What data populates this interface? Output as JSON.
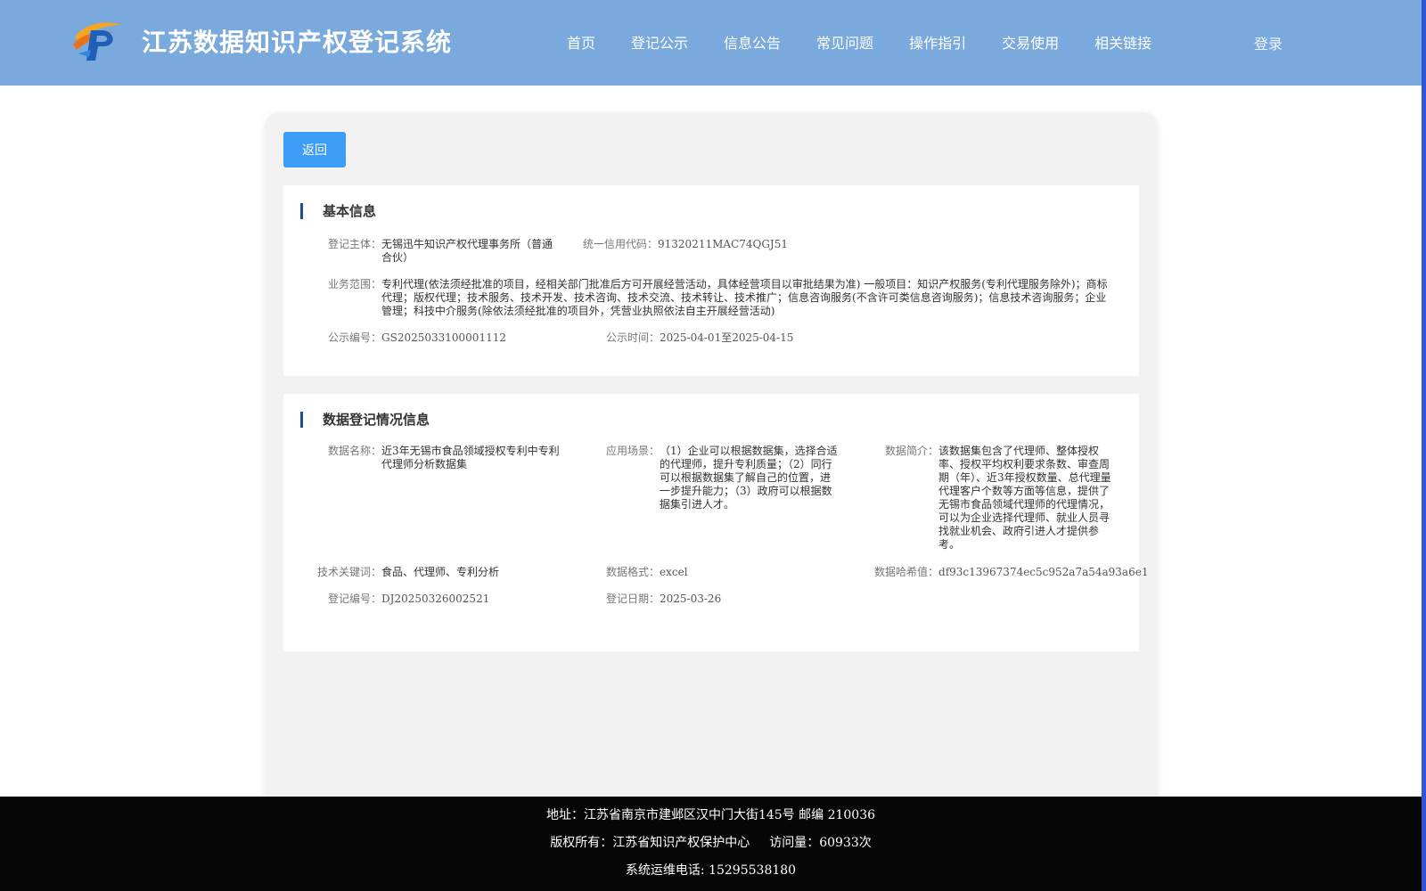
{
  "header": {
    "site_title": "江苏数据知识产权登记系统",
    "nav": [
      "首页",
      "登记公示",
      "信息公告",
      "常见问题",
      "操作指引",
      "交易使用",
      "相关链接"
    ],
    "login": "登录"
  },
  "back_label": "返回",
  "basic": {
    "title": "基本信息",
    "subject_label": "登记主体：",
    "subject_value": "无锡迅牛知识产权代理事务所（普通合伙）",
    "credit_label": "统一信用代码：",
    "credit_value": "91320211MAC74QGJ51",
    "scope_label": "业务范围：",
    "scope_value": "专利代理(依法须经批准的项目，经相关部门批准后方可开展经营活动，具体经营项目以审批结果为准) 一般项目：知识产权服务(专利代理服务除外)；商标代理；版权代理；技术服务、技术开发、技术咨询、技术交流、技术转让、技术推广；信息咨询服务(不含许可类信息咨询服务)；信息技术咨询服务；企业管理；科技中介服务(除依法须经批准的项目外，凭营业执照依法自主开展经营活动)",
    "notice_no_label": "公示编号：",
    "notice_no_value": "GS2025033100001112",
    "notice_time_label": "公示时间：",
    "notice_time_value": "2025-04-01至2025-04-15"
  },
  "data_reg": {
    "title": "数据登记情况信息",
    "name_label": "数据名称：",
    "name_value": "近3年无锡市食品领域授权专利中专利代理师分析数据集",
    "scene_label": "应用场景：",
    "scene_value": "（1）企业可以根据数据集，选择合适的代理师，提升专利质量；（2）同行可以根据数据集了解自己的位置，进一步提升能力；（3）政府可以根据数据集引进人才。",
    "intro_label": "数据简介：",
    "intro_value": "该数据集包含了代理师、整体授权率、授权平均权利要求条数、审查周期（年）、近3年授权数量、总代理量代理客户个数等方面等信息，提供了无锡市食品领域代理师的代理情况，可以为企业选择代理师、就业人员寻找就业机会、政府引进人才提供参考。",
    "keywords_label": "技术关键词：",
    "keywords_value": "食品、代理师、专利分析",
    "format_label": "数据格式：",
    "format_value": "excel",
    "hash_label": "数据哈希值：",
    "hash_value": "df93c13967374ec5c952a7a54a93a6e1",
    "reg_no_label": "登记编号：",
    "reg_no_value": "DJ20250326002521",
    "reg_date_label": "登记日期：",
    "reg_date_value": "2025-03-26"
  },
  "footer": {
    "address": "地址：江苏省南京市建邺区汉中门大街145号 邮编 210036",
    "copyright": "版权所有：江苏省知识产权保护中心",
    "visits": "访问量：60933次",
    "phone": "系统运维电话: 15295538180"
  },
  "colors": {
    "header_bg": "#7aa9dd",
    "button": "#3d9cf5",
    "section_bar": "#1d4e8f",
    "footer_bg": "#060606"
  }
}
